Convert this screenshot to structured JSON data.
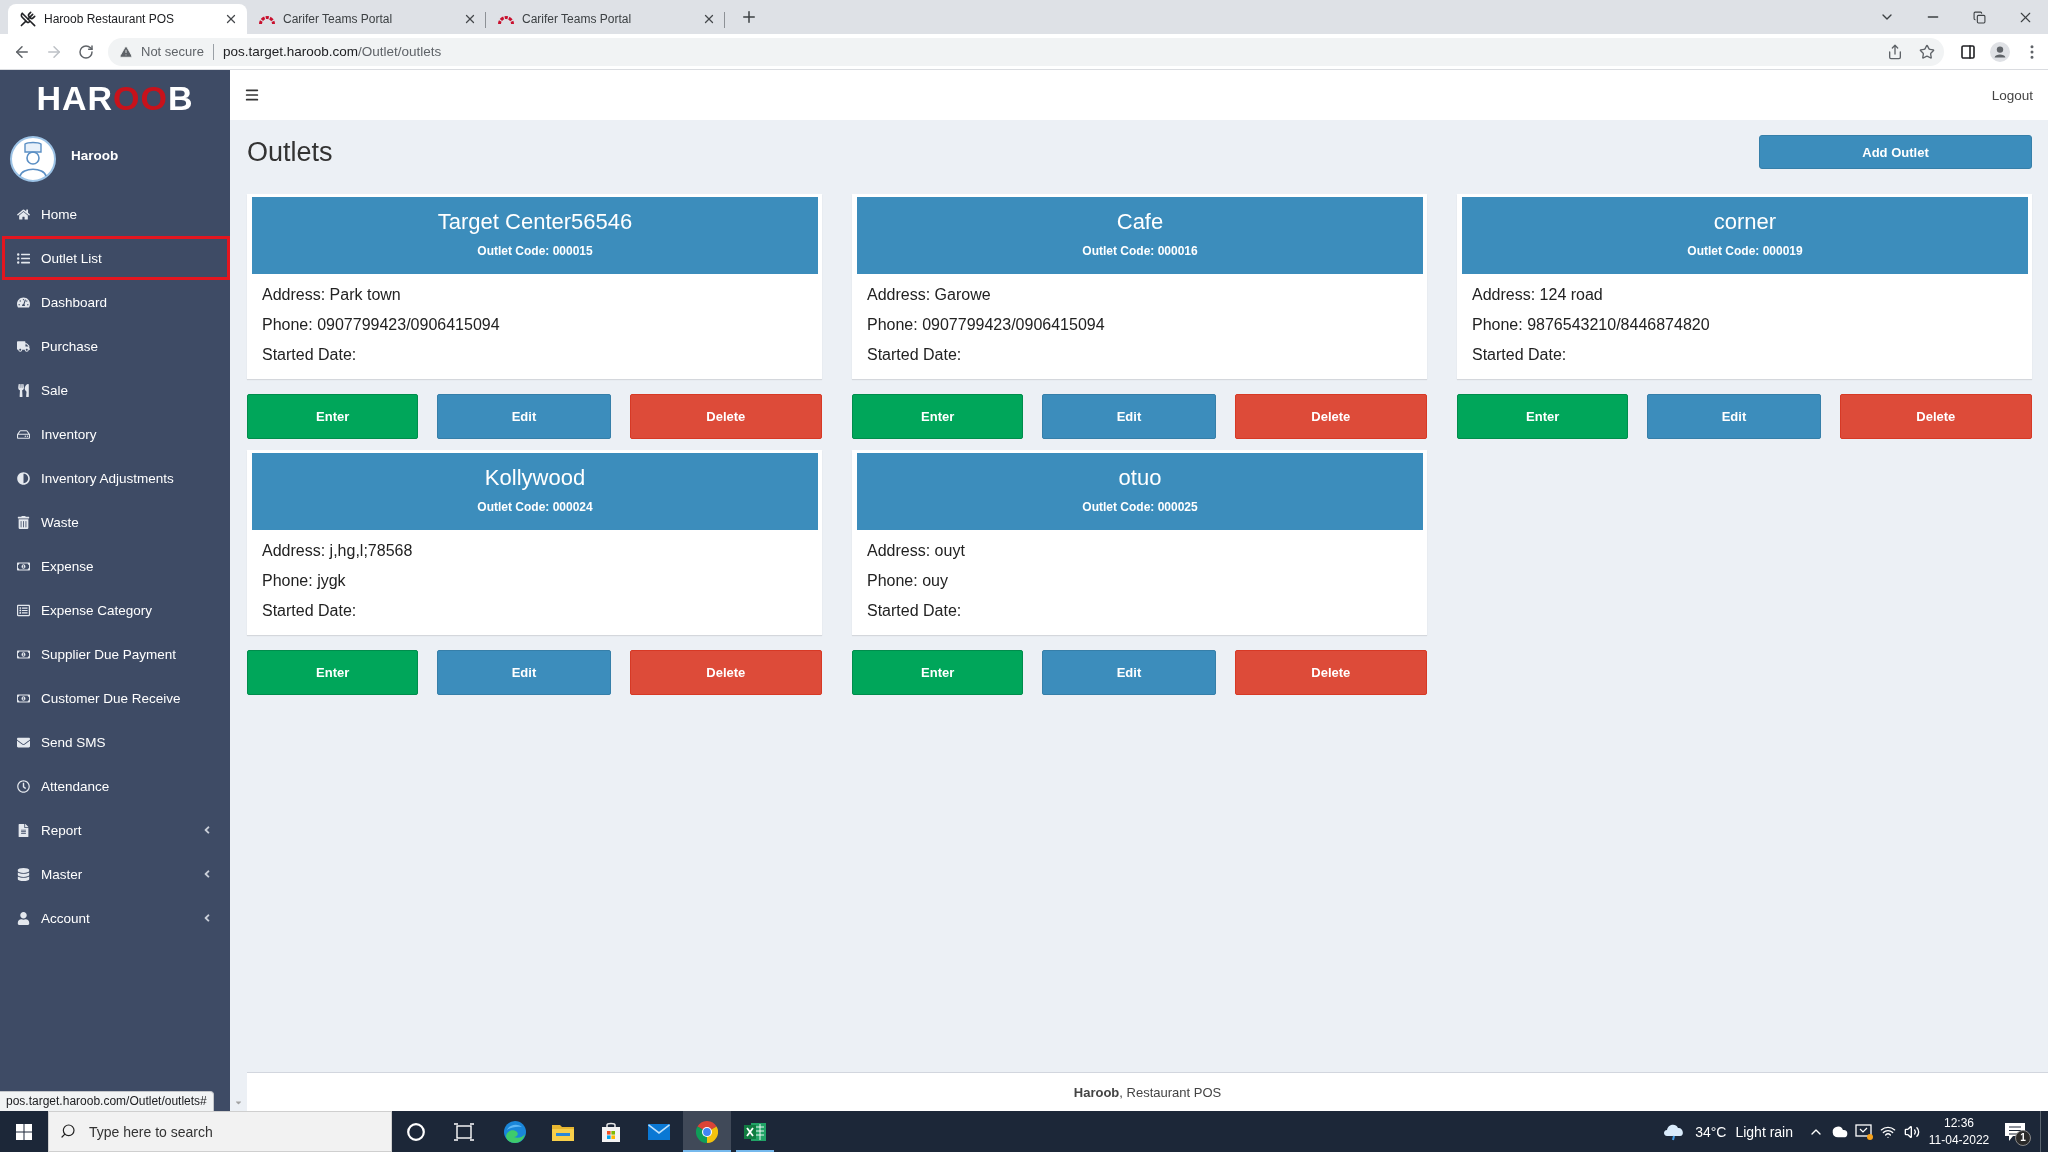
{
  "browser": {
    "tabs": [
      {
        "title": "Haroob Restaurant POS",
        "selected": true
      },
      {
        "title": "Carifer Teams Portal",
        "selected": false
      },
      {
        "title": "Carifer Teams Portal",
        "selected": false
      }
    ],
    "forward_button": {
      "disabled": true
    },
    "address": {
      "security": "Not secure",
      "host": "pos.target.haroob.com",
      "path": "/Outlet/outlets"
    },
    "status_bubble": "pos.target.haroob.com/Outlet/outlets#"
  },
  "sidebar": {
    "logo": "HAROOB",
    "user": {
      "name": "Haroob"
    },
    "items": [
      {
        "label": "Home",
        "selected": false,
        "has_submenu": false
      },
      {
        "label": "Outlet List",
        "selected": true,
        "has_submenu": false
      },
      {
        "label": "Dashboard",
        "selected": false,
        "has_submenu": false
      },
      {
        "label": "Purchase",
        "selected": false,
        "has_submenu": false
      },
      {
        "label": "Sale",
        "selected": false,
        "has_submenu": false
      },
      {
        "label": "Inventory",
        "selected": false,
        "has_submenu": false
      },
      {
        "label": "Inventory Adjustments",
        "selected": false,
        "has_submenu": false
      },
      {
        "label": "Waste",
        "selected": false,
        "has_submenu": false
      },
      {
        "label": "Expense",
        "selected": false,
        "has_submenu": false
      },
      {
        "label": "Expense Category",
        "selected": false,
        "has_submenu": false
      },
      {
        "label": "Supplier Due Payment",
        "selected": false,
        "has_submenu": false
      },
      {
        "label": "Customer Due Receive",
        "selected": false,
        "has_submenu": false
      },
      {
        "label": "Send SMS",
        "selected": false,
        "has_submenu": false
      },
      {
        "label": "Attendance",
        "selected": false,
        "has_submenu": false
      },
      {
        "label": "Report",
        "selected": false,
        "has_submenu": true
      },
      {
        "label": "Master",
        "selected": false,
        "has_submenu": true
      },
      {
        "label": "Account",
        "selected": false,
        "has_submenu": true
      }
    ]
  },
  "header": {
    "logout": "Logout"
  },
  "page": {
    "title": "Outlets",
    "add_button": "Add Outlet"
  },
  "outlets": [
    {
      "name": "Target Center56546",
      "code": "Outlet Code: 000015",
      "address": "Address: Park town",
      "phone": "Phone: 0907799423/0906415094",
      "started": "Started Date:",
      "actions": [
        {
          "label": "Enter",
          "kind": "enter"
        },
        {
          "label": "Edit",
          "kind": "edit"
        },
        {
          "label": "Delete",
          "kind": "delete"
        }
      ]
    },
    {
      "name": "Cafe",
      "code": "Outlet Code: 000016",
      "address": "Address: Garowe",
      "phone": "Phone: 0907799423/0906415094",
      "started": "Started Date:",
      "actions": [
        {
          "label": "Enter",
          "kind": "enter"
        },
        {
          "label": "Edit",
          "kind": "edit"
        },
        {
          "label": "Delete",
          "kind": "delete"
        }
      ]
    },
    {
      "name": "corner",
      "code": "Outlet Code: 000019",
      "address": "Address: 124 road",
      "phone": "Phone: 9876543210/8446874820",
      "started": "Started Date:",
      "actions": [
        {
          "label": "Enter",
          "kind": "enter"
        },
        {
          "label": "Edit",
          "kind": "edit"
        },
        {
          "label": "Delete",
          "kind": "delete"
        }
      ]
    },
    {
      "name": "Kollywood",
      "code": "Outlet Code: 000024",
      "address": "Address: j,hg,l;78568",
      "phone": "Phone: jygk",
      "started": "Started Date:",
      "actions": [
        {
          "label": "Enter",
          "kind": "enter"
        },
        {
          "label": "Edit",
          "kind": "edit"
        },
        {
          "label": "Delete",
          "kind": "delete"
        }
      ]
    },
    {
      "name": "otuo",
      "code": "Outlet Code: 000025",
      "address": "Address: ouyt",
      "phone": "Phone: ouy",
      "started": "Started Date:",
      "actions": [
        {
          "label": "Enter",
          "kind": "enter"
        },
        {
          "label": "Edit",
          "kind": "edit"
        },
        {
          "label": "Delete",
          "kind": "delete"
        }
      ]
    }
  ],
  "footer": {
    "text": "**Haroob**, Restaurant POS"
  },
  "taskbar": {
    "search": {
      "placeholder": "Type here to search"
    },
    "apps": [
      {
        "running": false,
        "selected": false
      },
      {
        "running": false,
        "selected": false
      },
      {
        "running": false,
        "selected": false
      },
      {
        "running": false,
        "selected": false
      },
      {
        "running": true,
        "selected": true
      },
      {
        "running": true,
        "selected": false
      }
    ],
    "weather": {
      "temperature": "34°C",
      "condition": "Light rain"
    },
    "clock": {
      "time": "12:36",
      "date": "11-04-2022"
    },
    "notifications": {
      "count": "1"
    }
  }
}
